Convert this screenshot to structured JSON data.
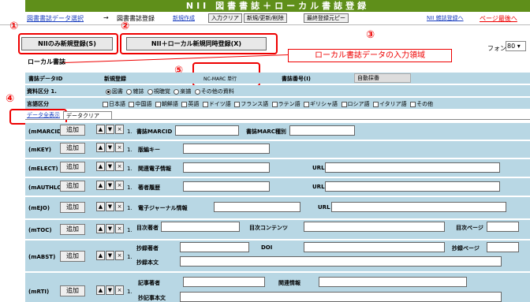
{
  "title": "NII 図書書誌＋ローカル書誌登録",
  "nav": {
    "select_link": "図書書誌データ選択",
    "arrow": "→",
    "current": "図書書誌登録",
    "create_link": "新規作成",
    "buttons": [
      "入力クリア",
      "新規/更新/削除",
      "最終登録元ピー"
    ],
    "right_link1": "NII 雑誌登録へ",
    "right_link2": "ページ最後へ"
  },
  "actions": {
    "nii_only": "NIIのみ新規登録(S)",
    "nii_local": "NII＋ローカル新規同時登録(X)"
  },
  "annotations": {
    "n1": "①",
    "n2": "②",
    "n3": "③",
    "n4": "④",
    "n5": "⑤",
    "callout": "ローカル書誌データの入力領域"
  },
  "font": {
    "label": "フォント",
    "value": "80"
  },
  "section_label": "ローカル書誌",
  "record": {
    "id_label": "書誌データID",
    "id_value": "新規登録",
    "ncmarc": "NC-MARC 単行",
    "code_label": "書誌番号(I)",
    "code_value": "自動採番",
    "type_label": "資料区分 1.",
    "type_options": [
      "図書",
      "雑誌",
      "視聴覚",
      "楽譜",
      "その他の資料"
    ],
    "type_selected": 0,
    "lang_label": "言語区分",
    "lang_options": [
      "日本語",
      "中国語",
      "朝鮮語",
      "英語",
      "ドイツ語",
      "フランス語",
      "ラテン語",
      "ギリシャ語",
      "ロシア語",
      "イタリア語",
      "その他"
    ]
  },
  "tabs": {
    "active": "データ全表示",
    "other": "データクリア"
  },
  "buttons": {
    "add": "追加",
    "up": "▲",
    "down": "▼",
    "del": "×",
    "one": "1."
  },
  "rows": [
    {
      "name": "(mMARCID)",
      "fields": [
        "書誌MARCID",
        "書誌MARC種別"
      ]
    },
    {
      "name": "(mKEY)",
      "fields": [
        "版編キー"
      ]
    },
    {
      "name": "(mELECT)",
      "fields": [
        "関連電子情報",
        "URL"
      ]
    },
    {
      "name": "(mAUTHLOG)",
      "fields": [
        "著者履歴",
        "URL"
      ]
    },
    {
      "name": "(mEJO)",
      "fields": [
        "電子ジャーナル情報",
        "URL"
      ]
    },
    {
      "name": "(mTOC)",
      "fields": [
        "目次著者",
        "目次コンテンツ",
        "目次ページ"
      ]
    },
    {
      "name": "(mABST)",
      "fields": [
        "抄録著者",
        "DOI",
        "抄録ページ",
        "抄録本文"
      ]
    },
    {
      "name": "(mRTI)",
      "fields": [
        "記事著者",
        "関連情報",
        "抄記事本文"
      ]
    }
  ]
}
